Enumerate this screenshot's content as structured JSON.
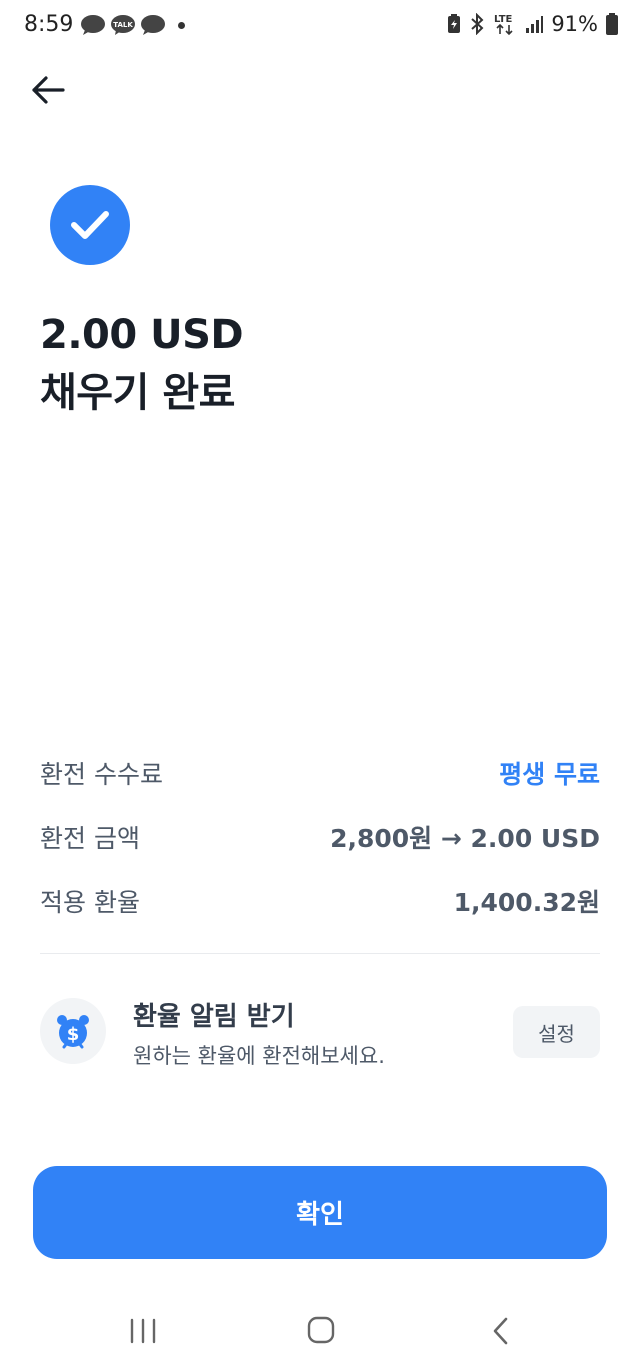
{
  "status_bar": {
    "time": "8:59",
    "network": "LTE",
    "battery": "91%",
    "left_icons": [
      "chat-bubble-icon",
      "kakaotalk-icon",
      "chat-bubble-icon",
      "notification-dot"
    ],
    "right_icons": [
      "battery-saver-icon",
      "bluetooth-icon",
      "lte-icon",
      "signal-icon",
      "battery-icon"
    ]
  },
  "header": {
    "back_icon": "arrow-left-icon"
  },
  "result": {
    "icon": "check-circle-icon",
    "amount_line": "2.00 USD",
    "status_line": "채우기 완료"
  },
  "details": [
    {
      "label": "환전 수수료",
      "value": "평생 무료",
      "accent": true
    },
    {
      "label": "환전 금액",
      "value": "2,800원 → 2.00 USD",
      "accent": false
    },
    {
      "label": "적용 환율",
      "value": "1,400.32원",
      "accent": false
    }
  ],
  "rate_alert": {
    "icon": "alarm-clock-dollar-icon",
    "title": "환율 알림 받기",
    "subtitle": "원하는 환율에 환전해보세요.",
    "button_label": "설정"
  },
  "confirm_label": "확인",
  "nav_bar": {
    "icons": [
      "recent-apps-icon",
      "home-icon",
      "back-icon"
    ]
  },
  "colors": {
    "accent": "#3182f6",
    "text_primary": "#191f28",
    "text_secondary": "#4e5968",
    "surface": "#f2f4f6"
  }
}
